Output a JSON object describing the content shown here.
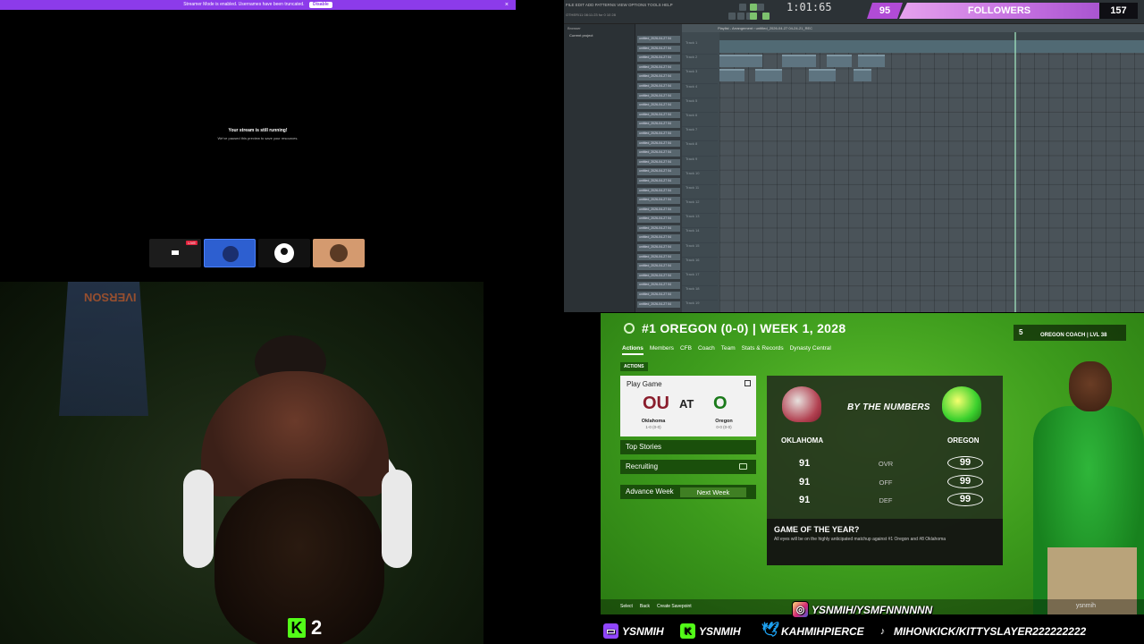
{
  "browser": {
    "streamer_mode_text": "Streamer Mode is enabled. Usernames have been truncated.",
    "disable_label": "Disable",
    "close_glyph": "×",
    "paused_title": "Your stream is still running!",
    "paused_subtitle": "We've paused this preview to save your resources.",
    "live_badge": "LIVE"
  },
  "webcam": {
    "jersey_text": "IVERSON",
    "kick_viewer_count": "2",
    "kick_logo": "K"
  },
  "fl_studio": {
    "menu": "FILE EDIT ADD PATTERNS VIEW OPTIONS TOOLS HELP",
    "time": "1:01:65",
    "info_line": "OTHER/11 08:11:23 for 0 10 28",
    "browser_header": "Browser",
    "browser_row": "Current project",
    "playlist_header": "Playlist - Arrangement › untitled_2026-04-27 04-24-21_REC",
    "clips": [
      "untitled_2026-04-27 04",
      "untitled_2026-04-27 04",
      "untitled_2026-04-27 04",
      "untitled_2026-04-27 04",
      "untitled_2026-04-27 04",
      "untitled_2026-04-27 04",
      "untitled_2026-04-27 04",
      "untitled_2026-04-27 04",
      "untitled_2026-04-27 04",
      "untitled_2026-04-27 04",
      "untitled_2026-04-27 04",
      "untitled_2026-04-27 04",
      "untitled_2026-04-27 04",
      "untitled_2026-04-27 04",
      "untitled_2026-04-27 04",
      "untitled_2026-04-27 04",
      "untitled_2026-04-27 04",
      "untitled_2026-04-27 04",
      "untitled_2026-04-27 04",
      "untitled_2026-04-27 04",
      "untitled_2026-04-27 04",
      "untitled_2026-04-27 04",
      "untitled_2026-04-27 04",
      "untitled_2026-04-27 04",
      "untitled_2026-04-27 04",
      "untitled_2026-04-27 04",
      "untitled_2026-04-27 04",
      "untitled_2026-04-27 04",
      "untitled_2026-04-27 04"
    ],
    "tracks": [
      "Track 1",
      "Track 2",
      "Track 3",
      "Track 4",
      "Track 5",
      "Track 6",
      "Track 7",
      "Track 8",
      "Track 9",
      "Track 10",
      "Track 11",
      "Track 12",
      "Track 13",
      "Track 14",
      "Track 15",
      "Track 16",
      "Track 17",
      "Track 18",
      "Track 19"
    ]
  },
  "followers": {
    "current": "95",
    "label": "FOLLOWERS",
    "goal": "157"
  },
  "game": {
    "title": "#1 OREGON (0-0) | WEEK 1, 2028",
    "coach_level_num": "5",
    "coach_text": "OREGON COACH | LVL 38",
    "nav": [
      "Actions",
      "Members",
      "CFB",
      "Coach",
      "Team",
      "Stats & Records",
      "Dynasty Central"
    ],
    "actions_tag": "ACTIONS",
    "play_game": {
      "label": "Play Game",
      "at": "AT",
      "away_logo": "OU",
      "home_logo": "O",
      "away_name": "Oklahoma",
      "away_record": "1-0 (0-0)",
      "home_name": "Oregon",
      "home_record": "0-0 (0-0)"
    },
    "top_stories": "Top Stories",
    "recruiting": "Recruiting",
    "advance_week": "Advance Week",
    "next_week": "Next Week",
    "by_numbers": {
      "title": "BY THE NUMBERS",
      "left_team": "OKLAHOMA",
      "right_team": "OREGON",
      "rows": [
        {
          "cat": "OVR",
          "left": "91",
          "right": "99"
        },
        {
          "cat": "OFF",
          "left": "91",
          "right": "99"
        },
        {
          "cat": "DEF",
          "left": "91",
          "right": "99"
        }
      ]
    },
    "goty_title": "GAME OF THE YEAR?",
    "goty_desc": "All eyes will be on the highly anticipated matchup against #1 Oregon and #8 Oklahoma",
    "footer": [
      "Select",
      "Back",
      "Create Savepoint"
    ],
    "footer_user": "ysnmih"
  },
  "social": {
    "instagram": "YSNMIH/YSMFNNNNNN",
    "twitch": "YSNMIH",
    "kick": "YSNMIH",
    "twitter": "KAHMIHPIERCE",
    "tiktok": "MIHONKICK/KITTYSLAYER222222222"
  }
}
